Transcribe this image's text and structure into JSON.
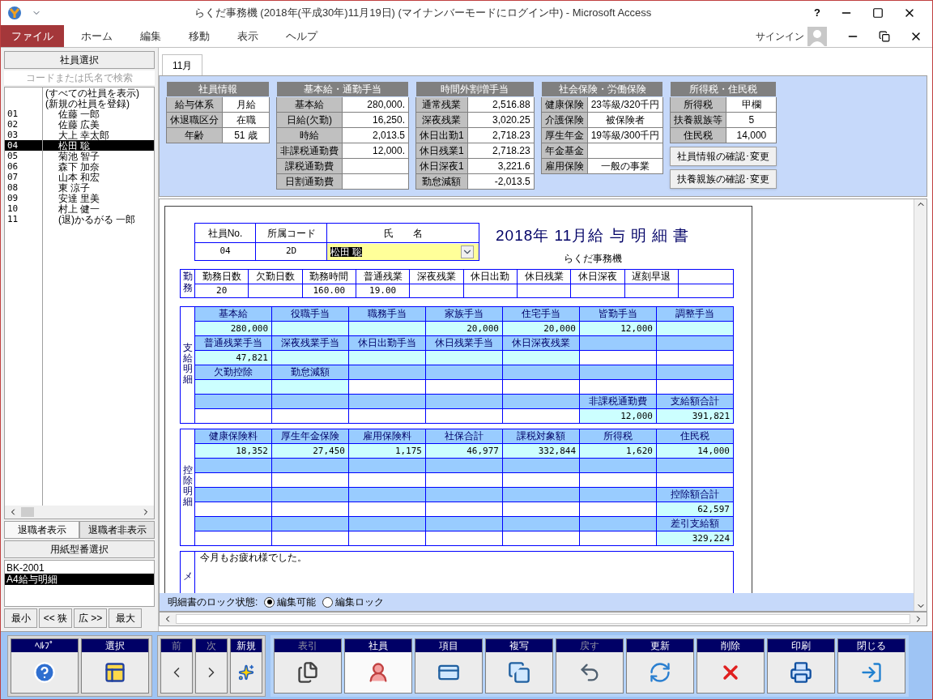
{
  "window": {
    "title": "らくだ事務機 (2018年(平成30年)11月19日) (マイナンバーモードにログイン中) - Microsoft Access",
    "help_label": "?"
  },
  "menu": [
    {
      "label": "ファイル",
      "selected": true
    },
    {
      "label": "ホーム",
      "selected": false
    },
    {
      "label": "編集",
      "selected": false
    },
    {
      "label": "移動",
      "selected": false
    },
    {
      "label": "表示",
      "selected": false
    },
    {
      "label": "ヘルプ",
      "selected": false
    }
  ],
  "account": {
    "label": "サインイン"
  },
  "employee_panel": {
    "title": "社員選択",
    "search": {
      "placeholder": "コードまたは氏名で検索"
    },
    "employees": [
      {
        "name": "(すべての社員を表示)",
        "selected": false
      },
      {
        "name": "(新規の社員を登録)",
        "selected": false
      },
      {
        "code": "01",
        "name": "佐藤 一郎",
        "selected": false
      },
      {
        "code": "02",
        "name": "佐藤 広美",
        "selected": false
      },
      {
        "code": "03",
        "name": "大上 幸太郎",
        "selected": false
      },
      {
        "code": "04",
        "name": "松田 聡",
        "selected": true
      },
      {
        "code": "05",
        "name": "菊池 智子",
        "selected": false
      },
      {
        "code": "06",
        "name": "森下 加奈",
        "selected": false
      },
      {
        "code": "07",
        "name": "山本 和宏",
        "selected": false
      },
      {
        "code": "08",
        "name": "東 涼子",
        "selected": false
      },
      {
        "code": "09",
        "name": "安達 里美",
        "selected": false
      },
      {
        "code": "10",
        "name": "村上 健一",
        "selected": false
      },
      {
        "code": "11",
        "name": "(退)かるがる 一郎",
        "selected": false
      }
    ],
    "tabs": [
      {
        "label": "退職者表示",
        "selected": true
      },
      {
        "label": "退職者非表示",
        "selected": false
      }
    ],
    "paper_title": "用紙型番選択",
    "papers": [
      {
        "label": "BK-2001",
        "selected": false
      },
      {
        "label": "A4給与明細",
        "selected": true
      }
    ],
    "zoom_buttons": [
      "最小",
      "<< 狭",
      "広 >>",
      "最大"
    ]
  },
  "tabs": [
    {
      "label": "11月",
      "selected": true
    }
  ],
  "info_sections": [
    {
      "title": "社員情報",
      "kind": "text",
      "rows": [
        {
          "label": "給与体系",
          "value": "月給"
        },
        {
          "label": "休退職区分",
          "value": "在職"
        },
        {
          "label": "年齢",
          "value": "51 歳"
        }
      ]
    },
    {
      "title": "基本給・通勤手当",
      "kind": "numeric",
      "rows": [
        {
          "label": "基本給",
          "value": "280,000."
        },
        {
          "label": "日給(欠勤)",
          "value": "16,250."
        },
        {
          "label": "時給",
          "value": "2,013.5"
        },
        {
          "label": "非課税通勤費",
          "value": "12,000."
        },
        {
          "label": "課税通勤費"
        },
        {
          "label": "日割通勤費"
        }
      ]
    },
    {
      "title": "時間外割増手当",
      "kind": "numeric",
      "rows": [
        {
          "label": "通常残業",
          "value": "2,516.88"
        },
        {
          "label": "深夜残業",
          "value": "3,020.25"
        },
        {
          "label": "休日出勤1",
          "value": "2,718.23"
        },
        {
          "label": "休日残業1",
          "value": "2,718.23"
        },
        {
          "label": "休日深夜1",
          "value": "3,221.6"
        },
        {
          "label": "勤怠減額",
          "value": "-2,013.5"
        }
      ]
    },
    {
      "title": "社会保険・労働保険",
      "kind": "text",
      "rows": [
        {
          "label": "健康保険",
          "value": "23等級/320千円"
        },
        {
          "label": "介護保険",
          "value": "被保険者"
        },
        {
          "label": "厚生年金",
          "value": "19等級/300千円"
        },
        {
          "label": "年金基金"
        },
        {
          "label": "雇用保険",
          "value": "一般の事業"
        }
      ]
    },
    {
      "title": "所得税・住民税",
      "kind": "mixed",
      "rows": [
        {
          "label": "所得税",
          "value": "甲欄"
        },
        {
          "label": "扶養親族等",
          "value": "5"
        },
        {
          "label": "住民税",
          "value": "14,000"
        }
      ]
    }
  ],
  "info_buttons": [
    "社員情報の確認･変更",
    "扶養親族の確認･変更"
  ],
  "payslip": {
    "header_columns": [
      "社員No.",
      "所属コード",
      "氏　　名"
    ],
    "employee_no": "04",
    "dept_code": "2D",
    "name": "松田 聡",
    "title": "2018年 11月給 与 明 細 書",
    "company": "らくだ事務機",
    "attendance": {
      "label": "勤務",
      "columns": [
        {
          "label": "勤務日数",
          "value": "20"
        },
        {
          "label": "欠勤日数"
        },
        {
          "label": "勤務時間",
          "value": "160.00"
        },
        {
          "label": "普通残業",
          "value": "19.00"
        },
        {
          "label": "深夜残業"
        },
        {
          "label": "休日出勤"
        },
        {
          "label": "休日残業"
        },
        {
          "label": "休日深夜"
        },
        {
          "label": "遅刻早退"
        }
      ]
    },
    "pay": {
      "label": "支給明細",
      "rows": [
        {
          "cells": [
            {
              "label": "基本給",
              "value": "280,000"
            },
            {
              "label": "役職手当"
            },
            {
              "label": "職務手当"
            },
            {
              "label": "家族手当",
              "value": "20,000"
            },
            {
              "label": "住宅手当",
              "value": "20,000"
            },
            {
              "label": "皆勤手当",
              "value": "12,000"
            },
            {
              "label": "調整手当"
            }
          ]
        },
        {
          "cells": [
            {
              "label": "普通残業手当",
              "value": "47,821"
            },
            {
              "label": "深夜残業手当"
            },
            {
              "label": "休日出勤手当"
            },
            {
              "label": "休日残業手当"
            },
            {
              "label": "休日深夜残業"
            },
            {},
            {}
          ]
        },
        {
          "cells": [
            {
              "label": "欠勤控除"
            },
            {
              "label": "勤怠減額"
            },
            {},
            {},
            {},
            {},
            {}
          ]
        },
        {
          "cells": [
            {},
            {},
            {},
            {},
            {},
            {
              "label": "非課税通勤費",
              "value": "12,000"
            },
            {
              "label": "支給額合計",
              "value": "391,821"
            }
          ]
        }
      ]
    },
    "deductions": {
      "label": "控除明細",
      "rows": [
        {
          "cells": [
            {
              "label": "健康保険料",
              "value": "18,352"
            },
            {
              "label": "厚生年金保険",
              "value": "27,450"
            },
            {
              "label": "雇用保険料",
              "value": "1,175"
            },
            {
              "label": "社保合計",
              "value": "46,977"
            },
            {
              "label": "課税対象額",
              "value": "332,844"
            },
            {
              "label": "所得税",
              "value": "1,620"
            },
            {
              "label": "住民税",
              "value": "14,000"
            }
          ]
        },
        {
          "cells": [
            {},
            {},
            {},
            {},
            {},
            {},
            {}
          ]
        },
        {
          "cells": [
            {},
            {},
            {},
            {},
            {},
            {},
            {
              "label": "控除額合計",
              "value": "62,597"
            }
          ]
        },
        {
          "cells": [
            {},
            {},
            {},
            {},
            {},
            {},
            {
              "label": "差引支給額",
              "value": "329,224"
            }
          ]
        }
      ]
    },
    "memo": {
      "label": "メ",
      "text": "今月もお疲れ様でした。"
    }
  },
  "lock": {
    "label": "明細書のロック状態:",
    "options": [
      {
        "label": "編集可能",
        "selected": true
      },
      {
        "label": "編集ロック",
        "selected": false
      }
    ]
  },
  "toolbar": [
    {
      "framed": true,
      "buttons": [
        {
          "label": "ﾍﾙﾌﾟ",
          "kind": "help",
          "disabled": false,
          "selected": false
        },
        {
          "label": "選択",
          "kind": "select",
          "disabled": false,
          "selected": false
        }
      ]
    },
    {
      "framed": true,
      "buttons": [
        {
          "label": "前",
          "kind": "prev",
          "disabled": true,
          "selected": false
        },
        {
          "label": "次",
          "kind": "next",
          "disabled": true,
          "selected": false
        },
        {
          "label": "新規",
          "kind": "new",
          "disabled": false,
          "selected": false
        }
      ]
    },
    {
      "framed": false,
      "buttons": [
        {
          "label": "表引",
          "kind": "index",
          "disabled": true,
          "selected": false
        },
        {
          "label": "社員",
          "kind": "employee",
          "disabled": false,
          "selected": true
        },
        {
          "label": "項目",
          "kind": "item",
          "disabled": false,
          "selected": false
        },
        {
          "label": "複写",
          "kind": "copy",
          "disabled": false,
          "selected": false
        },
        {
          "label": "戻す",
          "kind": "undo",
          "disabled": true,
          "selected": false
        },
        {
          "label": "更新",
          "kind": "refresh",
          "disabled": false,
          "selected": false
        },
        {
          "label": "削除",
          "kind": "delete",
          "disabled": false,
          "selected": false
        },
        {
          "label": "印刷",
          "kind": "print",
          "disabled": false,
          "selected": false
        },
        {
          "label": "閉じる",
          "kind": "close",
          "disabled": false,
          "selected": false
        }
      ]
    }
  ]
}
